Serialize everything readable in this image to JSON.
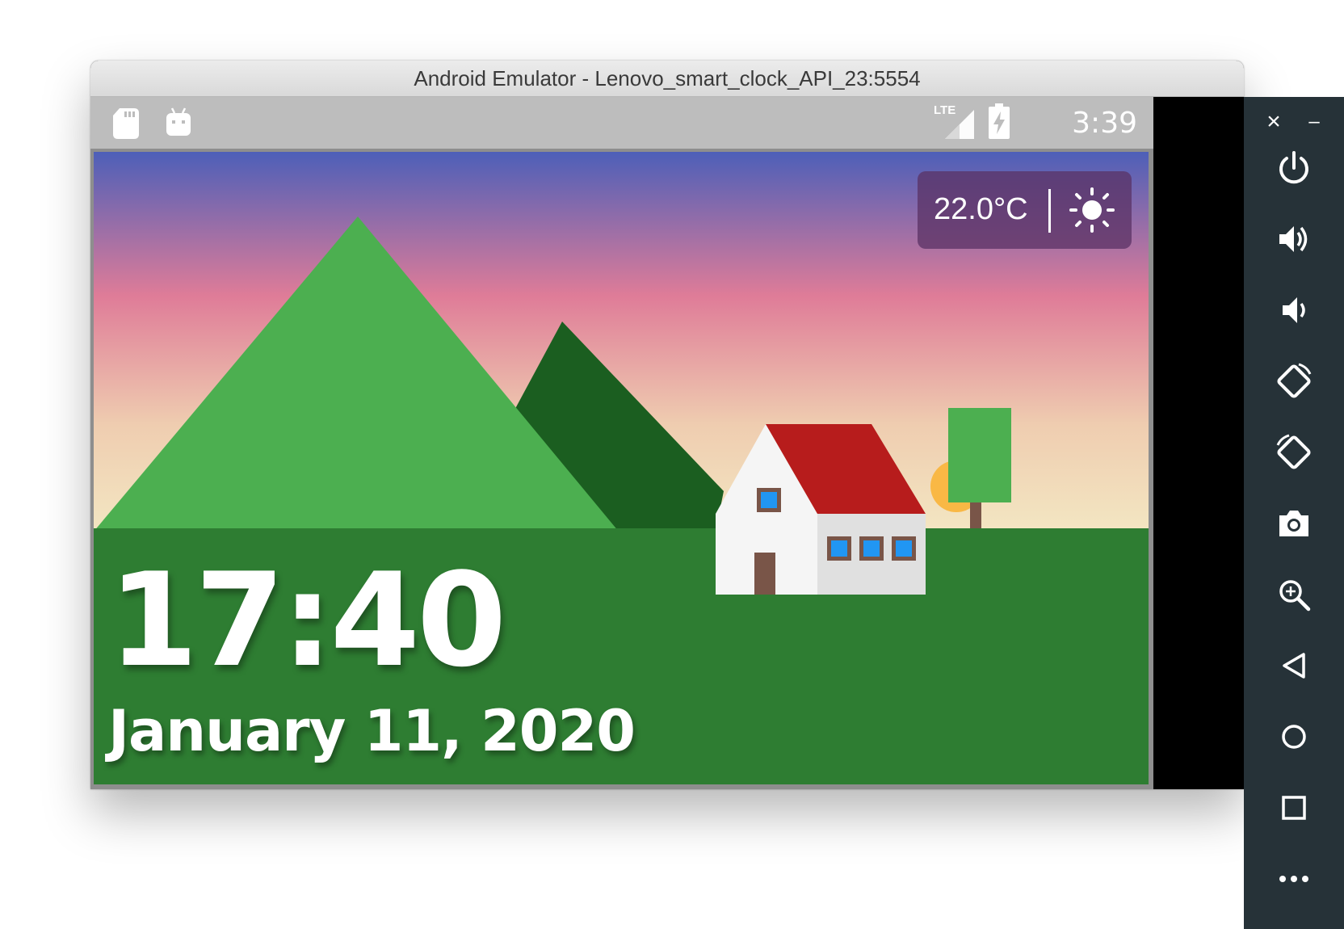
{
  "window": {
    "title": "Android Emulator - Lenovo_smart_clock_API_23:5554"
  },
  "status_bar": {
    "time": "3:39",
    "network_label": "LTE",
    "icons": [
      "sd-card-icon",
      "android-icon",
      "signal-icon",
      "battery-charging-icon"
    ]
  },
  "weather": {
    "temperature": "22.0°C",
    "condition_icon": "sun-icon"
  },
  "clock": {
    "time": "17:40",
    "date": "January 11, 2020"
  },
  "scene_colors": {
    "sky_top": "#4d5fb8",
    "sky_mid": "#e07c96",
    "sky_low": "#f2e4c0",
    "ground": "#2e7d32",
    "mountain_light": "#4caf50",
    "mountain_dark": "#1b5e20",
    "roof": "#b71c1c",
    "house_wall": "#f5f5f5",
    "window": "#2196f3",
    "door": "#795548",
    "tree": "#4caf50",
    "sun": "#f9b845"
  },
  "toolbar": {
    "close_label": "×",
    "minimize_label": "–",
    "buttons": [
      "power-icon",
      "volume-up-icon",
      "volume-down-icon",
      "rotate-left-icon",
      "rotate-right-icon",
      "camera-icon",
      "zoom-icon",
      "back-icon",
      "home-icon",
      "overview-icon",
      "more-icon"
    ]
  }
}
